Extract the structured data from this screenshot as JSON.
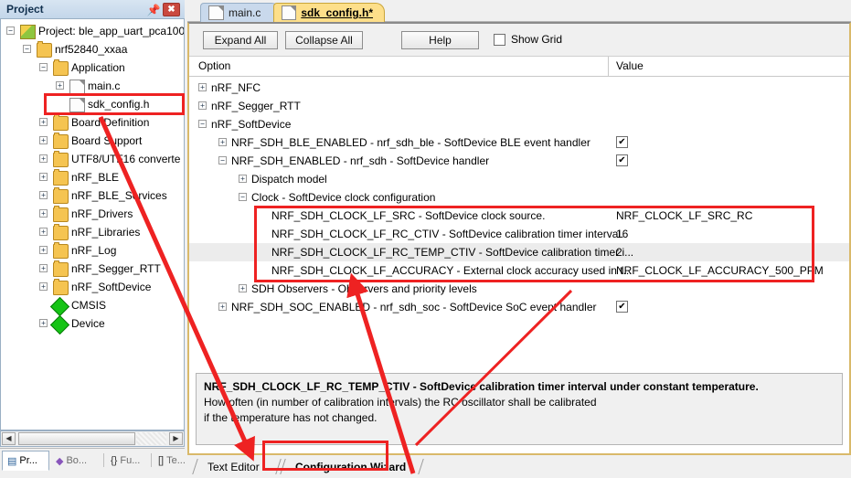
{
  "window": {
    "project_panel_title": "Project",
    "pin_icon": "pin-icon",
    "close_icon": "close-icon"
  },
  "project_tree": {
    "nodes": [
      {
        "label": "Project: ble_app_uart_pca100",
        "icon": "project-icon",
        "depth": 0,
        "expander": "minus"
      },
      {
        "label": "nrf52840_xxaa",
        "icon": "folder-target-icon",
        "depth": 1,
        "expander": "minus"
      },
      {
        "label": "Application",
        "icon": "folder-icon",
        "depth": 2,
        "expander": "minus"
      },
      {
        "label": "main.c",
        "icon": "document-icon",
        "depth": 3,
        "expander": "plus"
      },
      {
        "label": "sdk_config.h",
        "icon": "document-icon",
        "depth": 3,
        "expander": "none"
      },
      {
        "label": "Board Definition",
        "icon": "folder-icon",
        "depth": 2,
        "expander": "plus"
      },
      {
        "label": "Board Support",
        "icon": "folder-icon",
        "depth": 2,
        "expander": "plus"
      },
      {
        "label": "UTF8/UTF16 converte",
        "icon": "folder-icon",
        "depth": 2,
        "expander": "plus"
      },
      {
        "label": "nRF_BLE",
        "icon": "folder-icon",
        "depth": 2,
        "expander": "plus"
      },
      {
        "label": "nRF_BLE_Services",
        "icon": "folder-icon",
        "depth": 2,
        "expander": "plus"
      },
      {
        "label": "nRF_Drivers",
        "icon": "folder-icon",
        "depth": 2,
        "expander": "plus"
      },
      {
        "label": "nRF_Libraries",
        "icon": "folder-icon",
        "depth": 2,
        "expander": "plus"
      },
      {
        "label": "nRF_Log",
        "icon": "folder-icon",
        "depth": 2,
        "expander": "plus"
      },
      {
        "label": "nRF_Segger_RTT",
        "icon": "folder-icon",
        "depth": 2,
        "expander": "plus"
      },
      {
        "label": "nRF_SoftDevice",
        "icon": "folder-icon",
        "depth": 2,
        "expander": "plus"
      },
      {
        "label": "CMSIS",
        "icon": "diamond-icon",
        "depth": 2,
        "expander": "none"
      },
      {
        "label": "Device",
        "icon": "diamond-icon",
        "depth": 2,
        "expander": "plus"
      }
    ]
  },
  "bottom_panel_tabs": [
    {
      "label": "Pr...",
      "icon": "project-view-icon",
      "active": true
    },
    {
      "label": "Bo...",
      "icon": "bookmarks-icon",
      "active": false
    },
    {
      "label": "Fu...",
      "icon": "braces-icon",
      "active": false
    },
    {
      "label": "Te...",
      "icon": "templates-icon",
      "active": false
    }
  ],
  "editor_tabs": [
    {
      "label": "main.c",
      "active": false,
      "icon": "document-icon"
    },
    {
      "label": "sdk_config.h*",
      "active": true,
      "icon": "document-icon"
    }
  ],
  "toolbar": {
    "expand_all": "Expand All",
    "collapse_all": "Collapse All",
    "help": "Help",
    "show_grid": "Show Grid",
    "show_grid_checked": false
  },
  "columns": {
    "option": "Option",
    "value": "Value"
  },
  "config_rows": [
    {
      "label": "nRF_NFC",
      "depth": 0,
      "expander": "plus",
      "value": "",
      "type": "none",
      "selected": false
    },
    {
      "label": "nRF_Segger_RTT",
      "depth": 0,
      "expander": "plus",
      "value": "",
      "type": "none",
      "selected": false
    },
    {
      "label": "nRF_SoftDevice",
      "depth": 0,
      "expander": "minus",
      "value": "",
      "type": "none",
      "selected": false
    },
    {
      "label": "NRF_SDH_BLE_ENABLED - nrf_sdh_ble - SoftDevice BLE event handler",
      "depth": 1,
      "expander": "plus",
      "value": "",
      "type": "checkbox",
      "checked": true,
      "selected": false
    },
    {
      "label": "NRF_SDH_ENABLED - nrf_sdh - SoftDevice handler",
      "depth": 1,
      "expander": "minus",
      "value": "",
      "type": "checkbox",
      "checked": true,
      "selected": false
    },
    {
      "label": "Dispatch model",
      "depth": 2,
      "expander": "plus",
      "value": "",
      "type": "none",
      "selected": false
    },
    {
      "label": "Clock - SoftDevice clock configuration",
      "depth": 2,
      "expander": "minus",
      "value": "",
      "type": "none",
      "selected": false
    },
    {
      "label": "NRF_SDH_CLOCK_LF_SRC  - SoftDevice clock source.",
      "depth": 3,
      "expander": "none",
      "value": "NRF_CLOCK_LF_SRC_RC",
      "type": "text",
      "selected": false
    },
    {
      "label": "NRF_SDH_CLOCK_LF_RC_CTIV - SoftDevice calibration timer interval.",
      "depth": 3,
      "expander": "none",
      "value": "16",
      "type": "text",
      "selected": false
    },
    {
      "label": "NRF_SDH_CLOCK_LF_RC_TEMP_CTIV - SoftDevice calibration timer i...",
      "depth": 3,
      "expander": "none",
      "value": "2",
      "type": "text",
      "selected": true
    },
    {
      "label": "NRF_SDH_CLOCK_LF_ACCURACY  - External clock accuracy used in t...",
      "depth": 3,
      "expander": "none",
      "value": "NRF_CLOCK_LF_ACCURACY_500_PPM",
      "type": "text",
      "selected": false
    },
    {
      "label": "SDH Observers - Observers and priority levels",
      "depth": 2,
      "expander": "plus",
      "value": "",
      "type": "none",
      "selected": false
    },
    {
      "label": "NRF_SDH_SOC_ENABLED - nrf_sdh_soc - SoftDevice SoC event handler",
      "depth": 1,
      "expander": "plus",
      "value": "",
      "type": "checkbox",
      "checked": true,
      "selected": false
    }
  ],
  "description": {
    "line1": "NRF_SDH_CLOCK_LF_RC_TEMP_CTIV - SoftDevice calibration timer interval under constant temperature.",
    "line2": "How often (in number of calibration intervals) the RC oscillator shall be calibrated",
    "line3": "if the temperature has not changed."
  },
  "view_tabs": [
    {
      "label": "Text Editor",
      "active": false
    },
    {
      "label": "Configuration Wizard",
      "active": true
    }
  ],
  "colors": {
    "annotation": "#ee2222",
    "active_tab": "#fddf8a",
    "inactive_tab": "#c9d9ec",
    "selection": "#ececec"
  }
}
